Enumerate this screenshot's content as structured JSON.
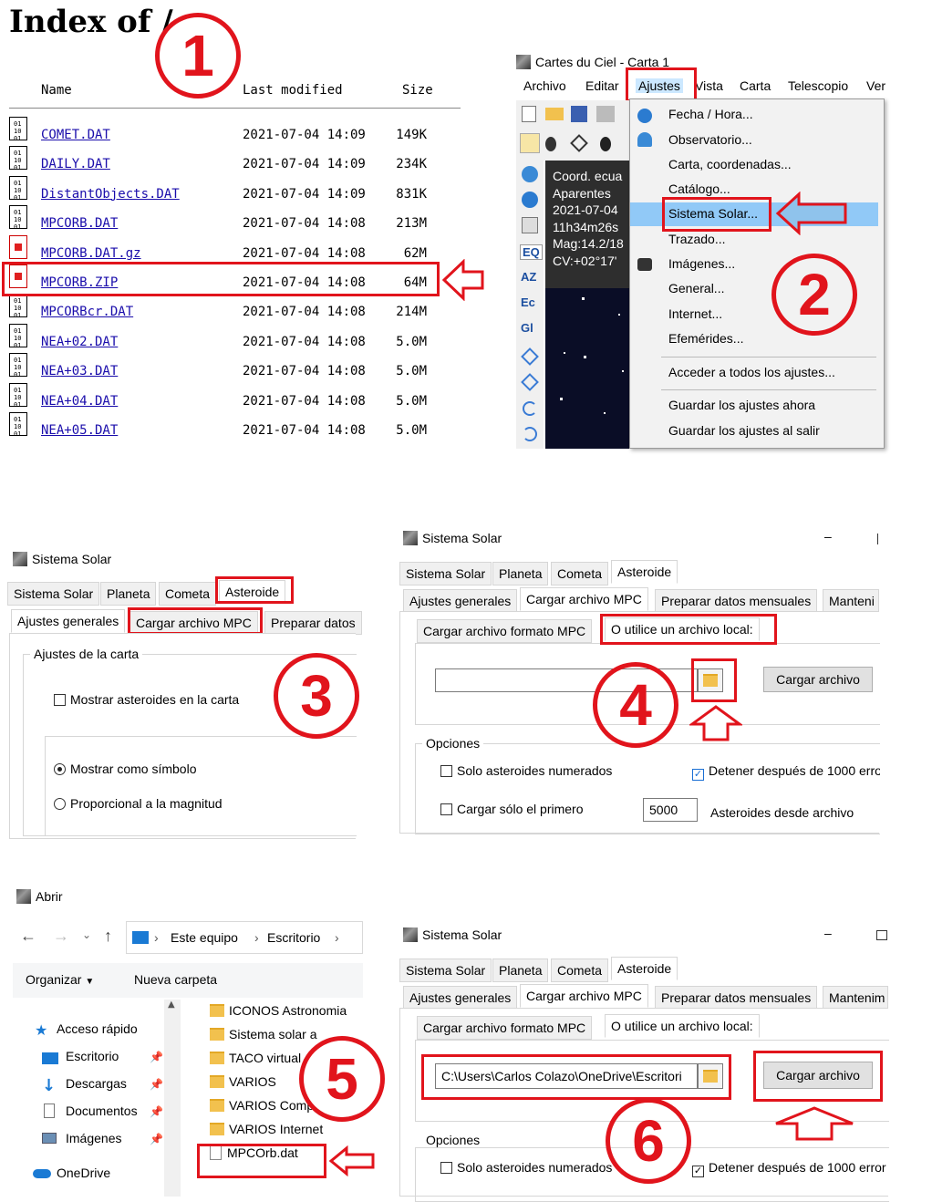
{
  "index": {
    "title": "Index of /",
    "columns": [
      "Name",
      "Last modified",
      "Size"
    ],
    "files": [
      {
        "name": "COMET.DAT",
        "date": "2021-07-04 14:09",
        "size": "149K"
      },
      {
        "name": "DAILY.DAT",
        "date": "2021-07-04 14:09",
        "size": "234K"
      },
      {
        "name": "DistantObjects.DAT",
        "date": "2021-07-04 14:09",
        "size": "831K"
      },
      {
        "name": "MPCORB.DAT",
        "date": "2021-07-04 14:08",
        "size": "213M"
      },
      {
        "name": "MPCORB.DAT.gz",
        "date": "2021-07-04 14:08",
        "size": "62M"
      },
      {
        "name": "MPCORB.ZIP",
        "date": "2021-07-04 14:08",
        "size": "64M"
      },
      {
        "name": "MPCORBcr.DAT",
        "date": "2021-07-04 14:08",
        "size": "214M"
      },
      {
        "name": "NEA+02.DAT",
        "date": "2021-07-04 14:08",
        "size": "5.0M"
      },
      {
        "name": "NEA+03.DAT",
        "date": "2021-07-04 14:08",
        "size": "5.0M"
      },
      {
        "name": "NEA+04.DAT",
        "date": "2021-07-04 14:08",
        "size": "5.0M"
      },
      {
        "name": "NEA+05.DAT",
        "date": "2021-07-04 14:08",
        "size": "5.0M"
      }
    ]
  },
  "steps": [
    "1",
    "2",
    "3",
    "4",
    "5",
    "6"
  ],
  "cartes": {
    "window_title": "Cartes du Ciel - Carta 1",
    "menu": [
      "Archivo",
      "Editar",
      "Ajustes",
      "Vista",
      "Carta",
      "Telescopio",
      "Ver"
    ],
    "info": [
      "Coord. ecua",
      "Aparentes",
      "2021-07-04",
      "11h34m26s",
      "Mag:14.2/18",
      "CV:+02°17'"
    ],
    "side_tools": [
      "EQ",
      "AZ",
      "Ec",
      "Gl"
    ],
    "dropdown": [
      "Fecha / Hora...",
      "Observatorio...",
      "Carta, coordenadas...",
      "Catálogo...",
      "Sistema Solar...",
      "Trazado...",
      "Imágenes...",
      "General...",
      "Internet...",
      "Efemérides...",
      "Acceder a todos los ajustes...",
      "Guardar los ajustes ahora",
      "Guardar los ajustes al salir"
    ]
  },
  "ss3": {
    "window_title": "Sistema Solar",
    "tabs": [
      "Sistema Solar",
      "Planeta",
      "Cometa",
      "Asteroide"
    ],
    "subtabs": [
      "Ajustes generales",
      "Cargar archivo MPC",
      "Preparar datos"
    ],
    "group": "Ajustes de la carta",
    "checkbox": "Mostrar asteroides en la carta",
    "radio1": "Mostrar como símbolo",
    "radio2": "Proporcional a la magnitud"
  },
  "ss4": {
    "window_title": "Sistema Solar",
    "minimize": "–",
    "tabs": [
      "Sistema Solar",
      "Planeta",
      "Cometa",
      "Asteroide"
    ],
    "subtabs": [
      "Ajustes generales",
      "Cargar archivo MPC",
      "Preparar datos mensuales",
      "Manteni"
    ],
    "subsubtabs": [
      "Cargar archivo formato MPC",
      "O utilice un archivo local:"
    ],
    "load_button": "Cargar archivo",
    "options_label": "Opciones",
    "opt1": "Solo asteroides numerados",
    "opt2": "Detener después de 1000 erro",
    "opt3": "Cargar sólo el primero",
    "count_value": "5000",
    "count_suffix": "Asteroides desde archivo"
  },
  "abrir": {
    "window_title": "Abrir",
    "breadcrumb": [
      "Este equipo",
      "Escritorio"
    ],
    "organize": "Organizar",
    "new_folder": "Nueva carpeta",
    "nav": [
      "Acceso rápido",
      "Escritorio",
      "Descargas",
      "Documentos",
      "Imágenes",
      "OneDrive"
    ],
    "files": [
      "ICONOS Astronomia",
      "Sistema solar a",
      "TACO virtual",
      "VARIOS",
      "VARIOS Comp",
      "VARIOS Internet",
      "MPCOrb.dat"
    ]
  },
  "ss6": {
    "window_title": "Sistema Solar",
    "tabs": [
      "Sistema Solar",
      "Planeta",
      "Cometa",
      "Asteroide"
    ],
    "subtabs": [
      "Ajustes generales",
      "Cargar archivo MPC",
      "Preparar datos mensuales",
      "Mantenim"
    ],
    "subsubtabs": [
      "Cargar archivo formato MPC",
      "O utilice un archivo local:"
    ],
    "path_value": "C:\\Users\\Carlos Colazo\\OneDrive\\Escritori",
    "load_button": "Cargar archivo",
    "options_label": "Opciones",
    "opt1": "Solo asteroides numerados",
    "opt2": "Detener después de 1000 error"
  }
}
